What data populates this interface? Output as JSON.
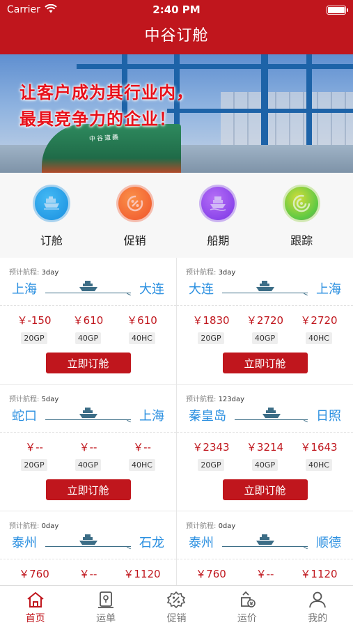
{
  "status_bar": {
    "carrier": "Carrier",
    "time": "2:40 PM"
  },
  "header": {
    "title": "中谷订舱"
  },
  "banner": {
    "slogan_line1": "让客户成为其行业内，",
    "slogan_line2": "最具竞争力的企业！",
    "ship_name": "中谷道義"
  },
  "quick_menu": [
    {
      "label": "订舱",
      "icon": "booking-icon",
      "color": "#1a8fe0"
    },
    {
      "label": "促销",
      "icon": "promotion-icon",
      "color": "#f0542c"
    },
    {
      "label": "船期",
      "icon": "ship-schedule-icon",
      "color": "#7b36e6"
    },
    {
      "label": "跟踪",
      "icon": "tracking-icon",
      "color": "#3fc64a"
    }
  ],
  "eta_label": "预计航程:",
  "book_label": "立即订舱",
  "container_types": [
    "20GP",
    "40GP",
    "40HC"
  ],
  "routes": [
    {
      "eta": "3day",
      "from": "上海",
      "to": "大连",
      "prices": [
        "￥-150",
        "￥610",
        "￥610"
      ]
    },
    {
      "eta": "3day",
      "from": "大连",
      "to": "上海",
      "prices": [
        "￥1830",
        "￥2720",
        "￥2720"
      ]
    },
    {
      "eta": "5day",
      "from": "蛇口",
      "to": "上海",
      "prices": [
        "￥--",
        "￥--",
        "￥--"
      ]
    },
    {
      "eta": "123day",
      "from": "秦皇岛",
      "to": "日照",
      "prices": [
        "￥2343",
        "￥3214",
        "￥1643"
      ]
    },
    {
      "eta": "0day",
      "from": "泰州",
      "to": "石龙",
      "prices": [
        "￥760",
        "￥--",
        "￥1120"
      ]
    },
    {
      "eta": "0day",
      "from": "泰州",
      "to": "顺德",
      "prices": [
        "￥760",
        "￥--",
        "￥1120"
      ]
    }
  ],
  "tabbar": [
    {
      "label": "首页",
      "icon": "home-icon",
      "active": true
    },
    {
      "label": "运单",
      "icon": "waybill-icon",
      "active": false
    },
    {
      "label": "促销",
      "icon": "promotion-icon",
      "active": false
    },
    {
      "label": "运价",
      "icon": "freight-rate-icon",
      "active": false
    },
    {
      "label": "我的",
      "icon": "profile-icon",
      "active": false
    }
  ],
  "colors": {
    "brand_red": "#c0161d",
    "port_blue": "#2a8fe0"
  }
}
